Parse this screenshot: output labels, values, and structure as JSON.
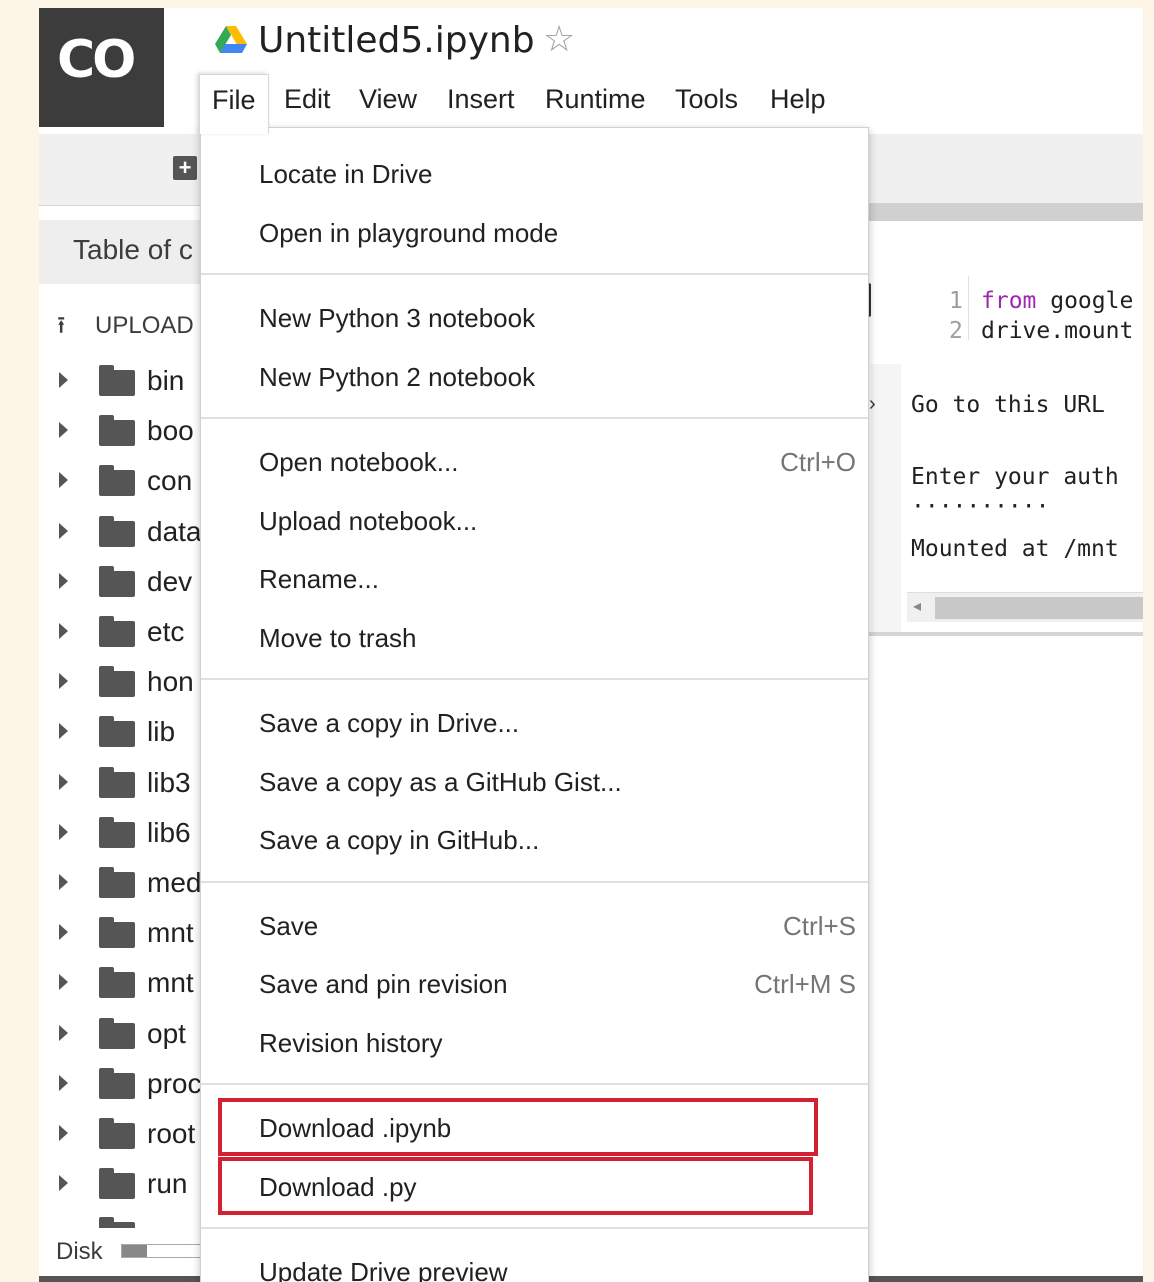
{
  "app": {
    "logo_text": "CO",
    "title": "Untitled5.ipynb",
    "star_glyph": "☆",
    "menus": [
      "File",
      "Edit",
      "View",
      "Insert",
      "Runtime",
      "Tools",
      "Help"
    ],
    "active_menu": "File"
  },
  "toolbar": {
    "add_glyph": "+"
  },
  "sidebar": {
    "heading": "Table of c",
    "upload_label": "UPLOAD",
    "upload_glyph": "⭱",
    "folders": [
      "bin",
      "boo",
      "con",
      "data",
      "dev",
      "etc",
      "hon",
      "lib",
      "lib3",
      "lib6",
      "med",
      "mnt",
      "mnt",
      "opt",
      "proc",
      "root",
      "run"
    ],
    "disk_label": "Disk",
    "disk_usage_fraction": 0.32
  },
  "cell": {
    "lines": [
      {
        "num": "1",
        "keyword": "from",
        "text": " google"
      },
      {
        "num": "2",
        "keyword": "",
        "text": "drive.mount"
      }
    ],
    "output": [
      "Go to this URL",
      "Enter your auth",
      "··········",
      "Mounted at /mnt"
    ],
    "scroll_arrow": "◂"
  },
  "file_menu": {
    "groups": [
      [
        {
          "label": "Locate in Drive",
          "shortcut": ""
        },
        {
          "label": "Open in playground mode",
          "shortcut": ""
        }
      ],
      [
        {
          "label": "New Python 3 notebook",
          "shortcut": ""
        },
        {
          "label": "New Python 2 notebook",
          "shortcut": ""
        }
      ],
      [
        {
          "label": "Open notebook...",
          "shortcut": "Ctrl+O"
        },
        {
          "label": "Upload notebook...",
          "shortcut": ""
        },
        {
          "label": "Rename...",
          "shortcut": ""
        },
        {
          "label": "Move to trash",
          "shortcut": ""
        }
      ],
      [
        {
          "label": "Save a copy in Drive...",
          "shortcut": ""
        },
        {
          "label": "Save a copy as a GitHub Gist...",
          "shortcut": ""
        },
        {
          "label": "Save a copy in GitHub...",
          "shortcut": ""
        }
      ],
      [
        {
          "label": "Save",
          "shortcut": "Ctrl+S"
        },
        {
          "label": "Save and pin revision",
          "shortcut": "Ctrl+M S"
        },
        {
          "label": "Revision history",
          "shortcut": ""
        }
      ],
      [
        {
          "label": "Download .ipynb",
          "shortcut": ""
        },
        {
          "label": "Download .py",
          "shortcut": ""
        }
      ],
      [
        {
          "label": "Update Drive preview",
          "shortcut": ""
        }
      ]
    ],
    "highlight_color": "#d32032"
  }
}
